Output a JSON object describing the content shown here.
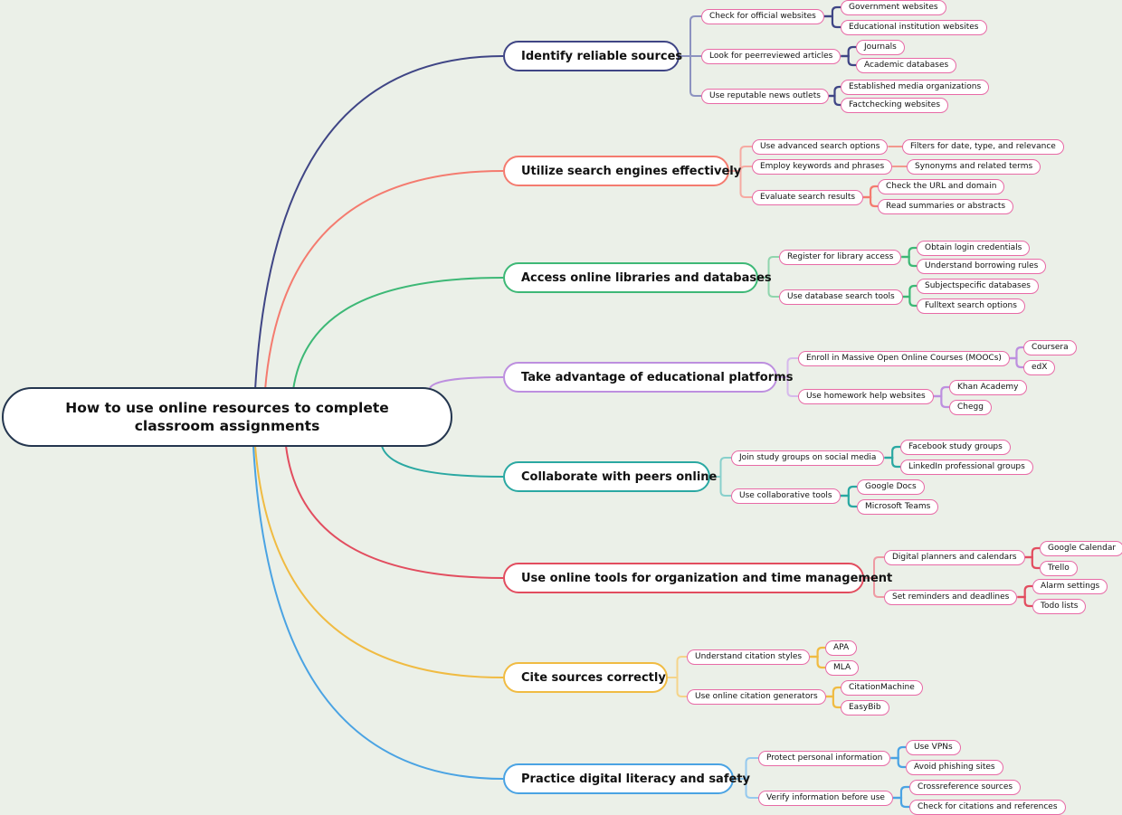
{
  "root": {
    "title": "How to use online resources to complete classroom assignments",
    "color": "#24364f"
  },
  "sub_border_color": "#e86aa6",
  "branches": [
    {
      "label": "Identify reliable sources",
      "color": "#3f4585",
      "light": "#8c92c0",
      "children": [
        {
          "label": "Check for official websites",
          "children": [
            "Government websites",
            "Educational institution websites"
          ]
        },
        {
          "label": "Look for peerreviewed articles",
          "children": [
            "Journals",
            "Academic databases"
          ]
        },
        {
          "label": "Use reputable news outlets",
          "children": [
            "Established media organizations",
            "Factchecking websites"
          ]
        }
      ]
    },
    {
      "label": "Utilize search engines effectively",
      "color": "#f47b6f",
      "light": "#f6aaa2",
      "children": [
        {
          "label": "Use advanced search options",
          "children": [
            "Filters for date, type, and relevance"
          ]
        },
        {
          "label": "Employ keywords and phrases",
          "children": [
            "Synonyms and related terms"
          ]
        },
        {
          "label": "Evaluate search results",
          "children": [
            "Check the URL and domain",
            "Read summaries or abstracts"
          ]
        }
      ]
    },
    {
      "label": "Access online libraries and databases",
      "color": "#3db876",
      "light": "#8fd5ad",
      "children": [
        {
          "label": "Register for library access",
          "children": [
            "Obtain login credentials",
            "Understand borrowing rules"
          ]
        },
        {
          "label": "Use database search tools",
          "children": [
            "Subjectspecific databases",
            "Fulltext search options"
          ]
        }
      ]
    },
    {
      "label": "Take advantage of educational platforms",
      "color": "#bd8fdf",
      "light": "#d6b9ec",
      "children": [
        {
          "label": "Enroll in Massive Open Online Courses (MOOCs)",
          "children": [
            "Coursera",
            "edX"
          ]
        },
        {
          "label": "Use homework help websites",
          "children": [
            "Khan Academy",
            "Chegg"
          ]
        }
      ]
    },
    {
      "label": "Collaborate with peers online",
      "color": "#2aa8a2",
      "light": "#88d0cc",
      "children": [
        {
          "label": "Join study groups on social media",
          "children": [
            "Facebook study groups",
            "LinkedIn professional groups"
          ]
        },
        {
          "label": "Use collaborative tools",
          "children": [
            "Google Docs",
            "Microsoft Teams"
          ]
        }
      ]
    },
    {
      "label": "Use online tools for organization and time management",
      "color": "#e24d5f",
      "light": "#ee9aa3",
      "children": [
        {
          "label": "Digital planners and calendars",
          "children": [
            "Google Calendar",
            "Trello"
          ]
        },
        {
          "label": "Set reminders and deadlines",
          "children": [
            "Alarm settings",
            "Todo lists"
          ]
        }
      ]
    },
    {
      "label": "Cite sources correctly",
      "color": "#f0bb42",
      "light": "#f5d48a",
      "children": [
        {
          "label": "Understand citation styles",
          "children": [
            "APA",
            "MLA"
          ]
        },
        {
          "label": "Use online citation generators",
          "children": [
            "CitationMachine",
            "EasyBib"
          ]
        }
      ]
    },
    {
      "label": "Practice digital literacy and safety",
      "color": "#4aa3e3",
      "light": "#95c9ee",
      "children": [
        {
          "label": "Protect personal information",
          "children": [
            "Use VPNs",
            "Avoid phishing sites"
          ]
        },
        {
          "label": "Verify information before use",
          "children": [
            "Crossreference sources",
            "Check for citations and references"
          ]
        }
      ]
    }
  ]
}
